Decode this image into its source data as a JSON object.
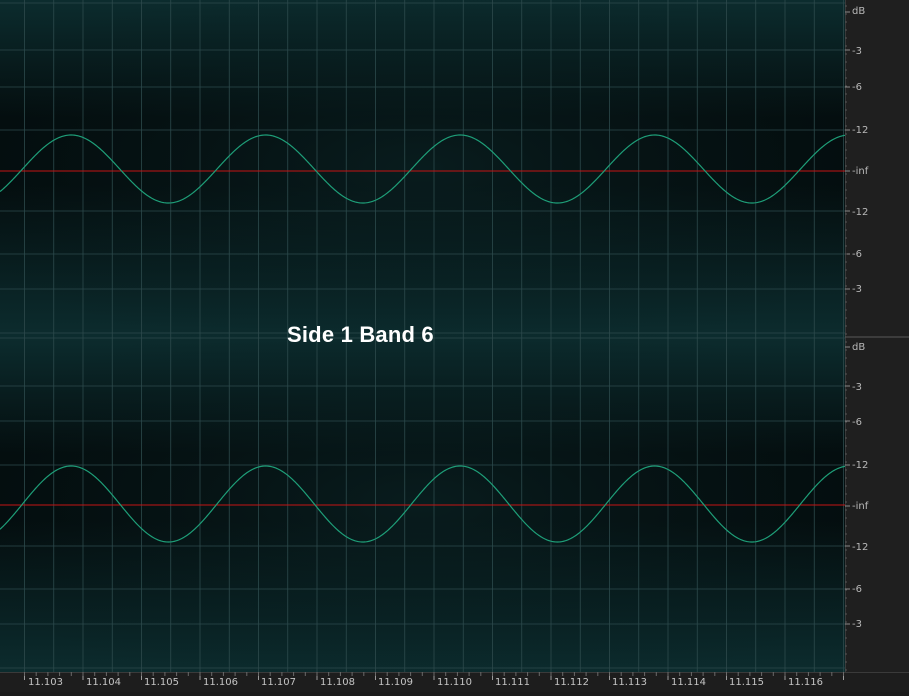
{
  "overlay_title": "Side 1 Band 6",
  "colors": {
    "background": "#06191b",
    "waveform": "#1e9e78",
    "center_line": "#c41414",
    "grid": "#2d4a4c"
  },
  "db_ruler": {
    "channel_1": [
      "dB",
      "-3",
      "-6",
      "-12",
      "-inf",
      "-12",
      "-6",
      "-3"
    ],
    "channel_2": [
      "dB",
      "-3",
      "-6",
      "-12",
      "-inf",
      "-12",
      "-6",
      "-3"
    ]
  },
  "time_ruler": {
    "labels": [
      "11.103",
      "11.104",
      "11.105",
      "11.106",
      "11.107",
      "11.108",
      "11.109",
      "11.110",
      "11.111",
      "11.112",
      "11.113",
      "11.114",
      "11.115",
      "11.116"
    ]
  }
}
